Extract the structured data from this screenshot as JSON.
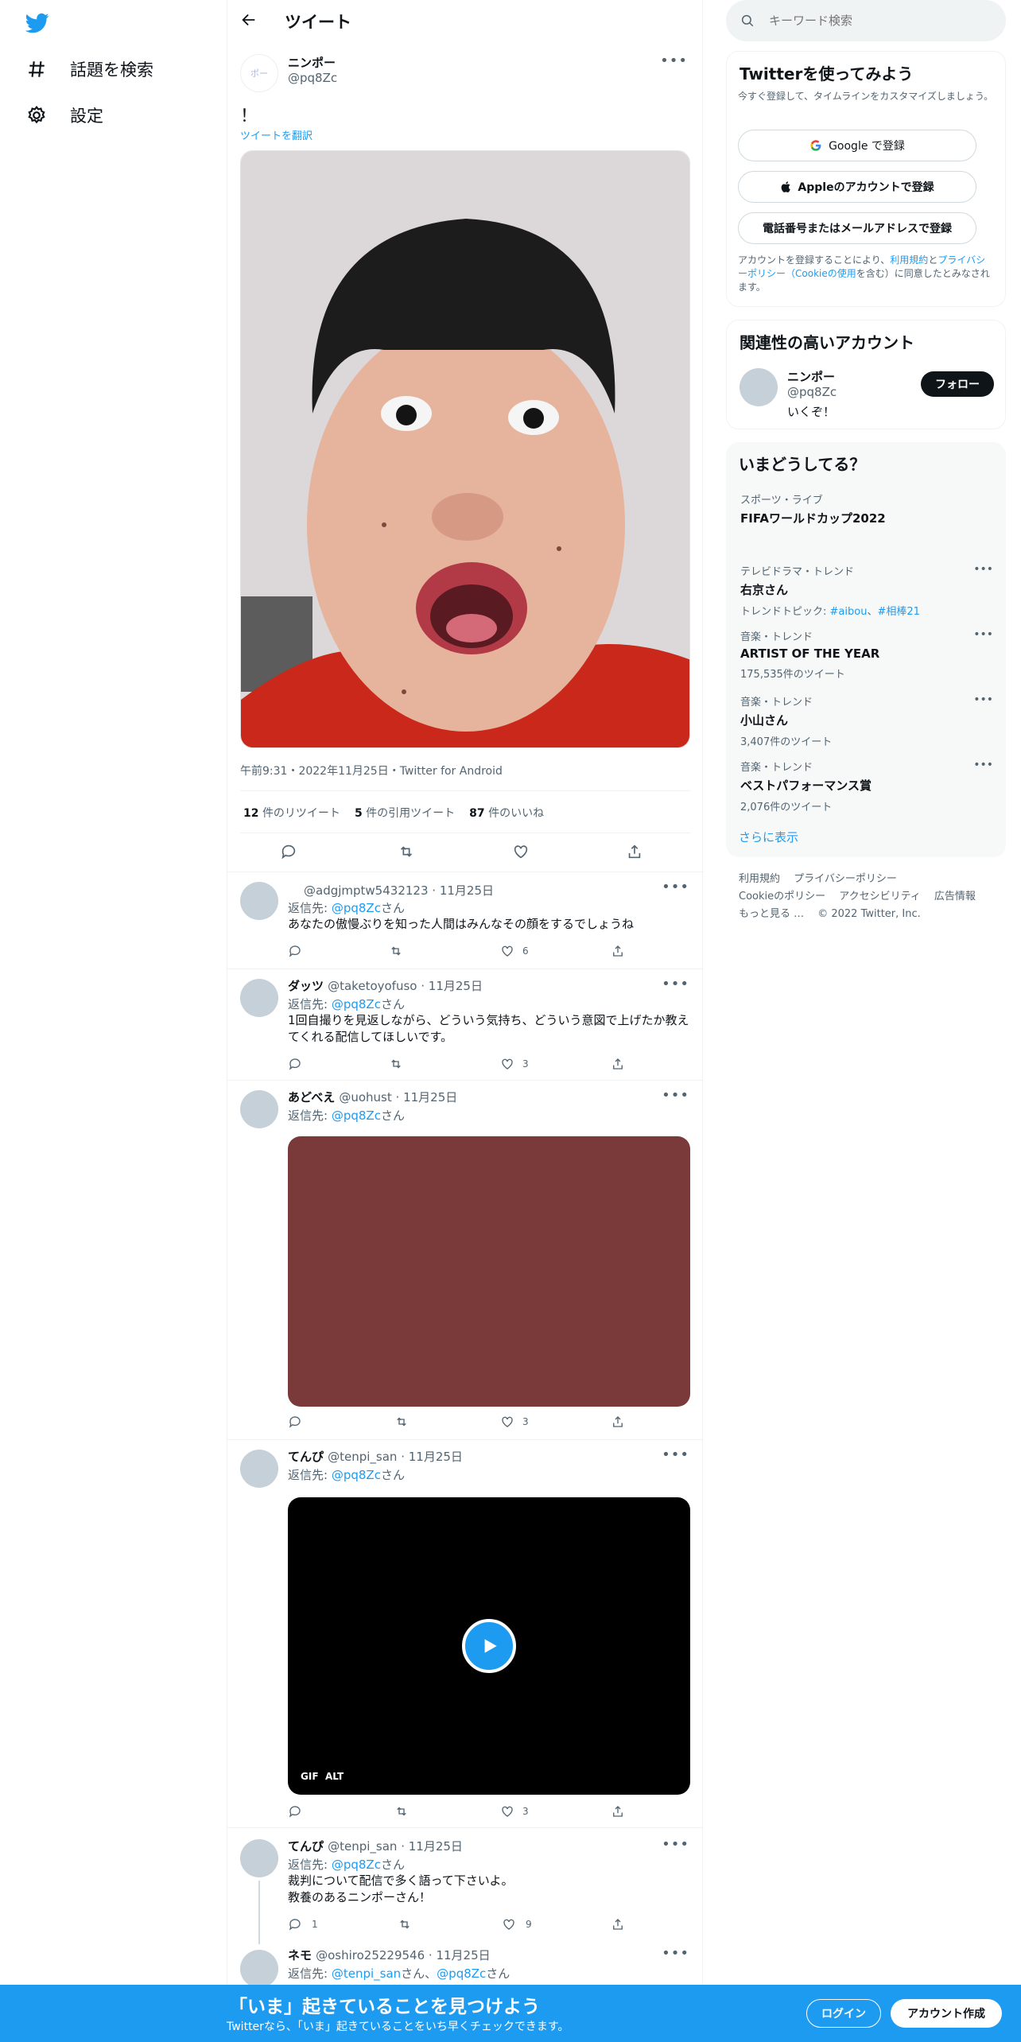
{
  "nav": {
    "items": [
      {
        "icon": "hashtag-icon",
        "label": "話題を検索"
      },
      {
        "icon": "gear-icon",
        "label": "設定"
      }
    ]
  },
  "header": {
    "title": "ツイート"
  },
  "tweet": {
    "author_name": "ニンポー",
    "author_handle": "@pq8Zc",
    "avatar_text": "ポー",
    "text": "！",
    "translate_label": "ツイートを翻訳",
    "timestamp": "午前9:31・2022年11月25日・Twitter for Android",
    "stats": {
      "retweets_count": "12",
      "retweets_label": "件のリツイート",
      "quotes_count": "5",
      "quotes_label": "件の引用ツイート",
      "likes_count": "87",
      "likes_label": "件のいいね"
    }
  },
  "replies": [
    {
      "name": "",
      "handle": "@adgjmptw5432123",
      "date": "11月25日",
      "reply_to_prefix": "返信先: ",
      "reply_to": "@pq8Zc",
      "reply_to_suffix": "さん",
      "text": "あなたの傲慢ぶりを知った人間はみんなその顔をするでしょうね",
      "likes": "6"
    },
    {
      "name": "ダッツ",
      "handle": "@taketoyofuso",
      "date": "11月25日",
      "reply_to_prefix": "返信先: ",
      "reply_to": "@pq8Zc",
      "reply_to_suffix": "さん",
      "text_line1": "1回自撮りを見返しながら、どういう気持ち、どういう意図で上げたか教え",
      "text_line2": "てくれる配信してほしいです。",
      "likes": "3"
    },
    {
      "name": "あどべえ",
      "handle": "@uohust",
      "date": "11月25日",
      "reply_to_prefix": "返信先: ",
      "reply_to": "@pq8Zc",
      "reply_to_suffix": "さん",
      "media_color": "#7a3a3a",
      "likes": "3"
    },
    {
      "name": "てんぴ",
      "handle": "@tenpi_san",
      "date": "11月25日",
      "reply_to_prefix": "返信先: ",
      "reply_to": "@pq8Zc",
      "reply_to_suffix": "さん",
      "badge_gif": "GIF",
      "badge_alt": "ALT",
      "likes": "3"
    },
    {
      "name": "てんぴ",
      "handle": "@tenpi_san",
      "date": "11月25日",
      "reply_to_prefix": "返信先: ",
      "reply_to": "@pq8Zc",
      "reply_to_suffix": "さん",
      "text_line1": "裁判について配信で多く語って下さいよ。",
      "text_line2": "教養のあるニンポーさん！",
      "replies": "1",
      "likes": "9"
    },
    {
      "name": "ネモ",
      "handle": "@oshiro25229546",
      "date": "11月25日",
      "reply_to_prefix": "返信先: ",
      "reply_to": "@tenpi_san",
      "reply_to_mid": "さん、",
      "reply_to2": "@pq8Zc",
      "reply_to_suffix": "さん"
    }
  ],
  "search": {
    "placeholder": "キーワード検索"
  },
  "signup": {
    "title": "Twitterを使ってみよう",
    "subtitle": "今すぐ登録して、タイムラインをカスタマイズしましょう。",
    "google_label": "Google で登録",
    "apple_label": "Appleのアカウントで登録",
    "phone_label": "電話番号またはメールアドレスで登録",
    "legal_prefix": "アカウントを登録することにより、",
    "legal_terms": "利用規約",
    "legal_and": "と",
    "legal_privacy": "プライバシーポリシー",
    "legal_cookie": "（Cookieの使用",
    "legal_suffix": "を含む）に同意したとみなされます。"
  },
  "relevant": {
    "title": "関連性の高いアカウント",
    "name": "ニンポー",
    "handle": "@pq8Zc",
    "bio": "いくぞ！",
    "follow_label": "フォロー"
  },
  "trends": {
    "title": "いまどうしてる？",
    "items": [
      {
        "category": "スポーツ・ライブ",
        "name": "FIFAワールドカップ2022",
        "sub": ""
      },
      {
        "category": "テレビドラマ・トレンド",
        "name": "右京さん",
        "sub_prefix": "トレンドトピック: ",
        "sub_tag1": "#aibou",
        "sub_sep": "、",
        "sub_tag2": "#相棒21"
      },
      {
        "category": "音楽・トレンド",
        "name": "ARTIST OF THE YEAR",
        "sub": "175,535件のツイート"
      },
      {
        "category": "音楽・トレンド",
        "name": "小山さん",
        "sub": "3,407件のツイート"
      },
      {
        "category": "音楽・トレンド",
        "name": "ベストパフォーマンス賞",
        "sub": "2,076件のツイート"
      }
    ],
    "show_more": "さらに表示"
  },
  "footer": {
    "links": [
      "利用規約",
      "プライバシーポリシー",
      "Cookieのポリシー",
      "アクセシビリティ",
      "広告情報",
      "もっと見る …"
    ],
    "copyright": "© 2022 Twitter, Inc."
  },
  "bottom": {
    "headline": "「いま」起きていることを見つけよう",
    "subline": "Twitterなら、「いま」起きていることをいち早くチェックできます。",
    "login_label": "ログイン",
    "signup_label": "アカウント作成"
  },
  "colors": {
    "accent": "#1d9bf0",
    "text": "#0f1419",
    "muted": "#536471"
  }
}
